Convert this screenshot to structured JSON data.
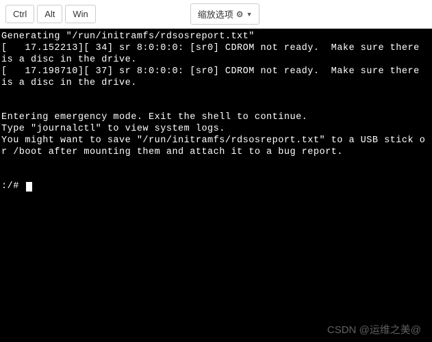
{
  "toolbar": {
    "ctrl": "Ctrl",
    "alt": "Alt",
    "win": "Win",
    "zoom": "缩放选项"
  },
  "terminal": {
    "line1": "Generating \"/run/initramfs/rdsosreport.txt\"",
    "line2": "[   17.152213][ 34] sr 8:0:0:0: [sr0] CDROM not ready.  Make sure there is a disc in the drive.",
    "line3": "[   17.198710][ 37] sr 8:0:0:0: [sr0] CDROM not ready.  Make sure there is a disc in the drive.",
    "blank1": "",
    "blank2": "",
    "line4": "Entering emergency mode. Exit the shell to continue.",
    "line5": "Type \"journalctl\" to view system logs.",
    "line6": "You might want to save \"/run/initramfs/rdsosreport.txt\" to a USB stick or /boot after mounting them and attach it to a bug report.",
    "blank3": "",
    "blank4": "",
    "prompt": ":/# "
  },
  "watermark": "CSDN @运维之美@"
}
